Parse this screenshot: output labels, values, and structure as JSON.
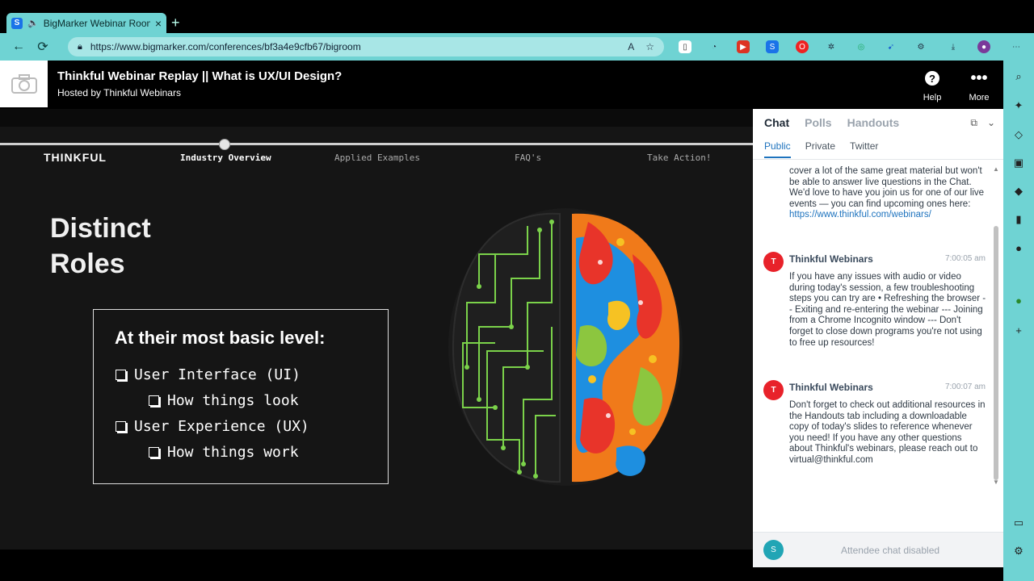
{
  "browser": {
    "tab_title": "BigMarker Webinar Room",
    "url": "https://www.bigmarker.com/conferences/bf3a4e9cfb67/bigroom",
    "new_tab_label": "+"
  },
  "header": {
    "title": "Thinkful Webinar Replay || What is UX/UI Design?",
    "host": "Hosted by Thinkful Webinars",
    "help_label": "Help",
    "more_label": "More"
  },
  "slide": {
    "brand": "THINKFUL",
    "nav": [
      "Industry Overview",
      "Applied Examples",
      "FAQ's",
      "Take Action!"
    ],
    "active_nav": "Industry Overview",
    "heading_line1": "Distinct",
    "heading_line2": "Roles",
    "box_title": "At their most basic level:",
    "bullets": [
      {
        "text": "User Interface (UI)",
        "level": 1
      },
      {
        "text": "How things look",
        "level": 2
      },
      {
        "text": "User Experience (UX)",
        "level": 1
      },
      {
        "text": "How things work",
        "level": 2
      }
    ],
    "progress": 0.3
  },
  "chat": {
    "tabs": [
      "Chat",
      "Polls",
      "Handouts"
    ],
    "subtabs": [
      "Public",
      "Private",
      "Twitter"
    ],
    "partial_message": "cover a lot of the same great material but won't be able to answer live questions in the Chat. We'd love to have you join us for one of our live events — you can find upcoming ones here:",
    "partial_link": "https://www.thinkful.com/webinars/",
    "messages": [
      {
        "avatar": "T",
        "author": "Thinkful Webinars",
        "time": "7:00:05 am",
        "text": "If you have any issues with audio or video during today's session, a few troubleshooting steps you can try are • Refreshing the browser -- Exiting and re-entering the webinar --- Joining from a Chrome Incognito window --- Don't forget to close down programs you're not using to free up resources!"
      },
      {
        "avatar": "T",
        "author": "Thinkful Webinars",
        "time": "7:00:07 am",
        "text": "Don't forget to check out additional resources in the Handouts tab including a downloadable copy of today's slides to reference whenever you need! If you have any other questions about Thinkful's webinars, please reach out to virtual@thinkful.com"
      }
    ],
    "footer_avatar": "S",
    "footer_text": "Attendee chat disabled"
  }
}
